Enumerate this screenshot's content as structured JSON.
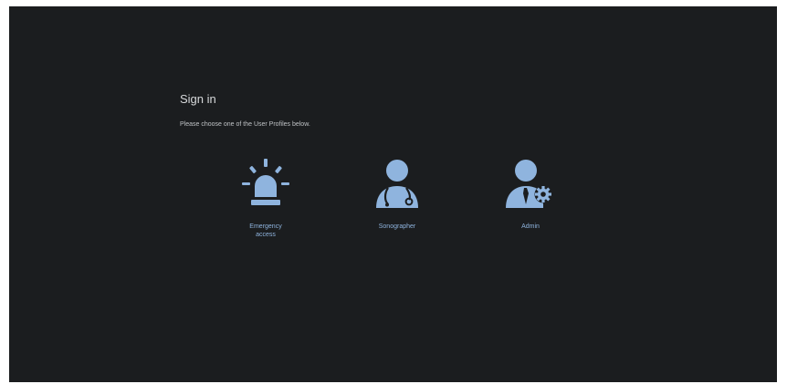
{
  "signin": {
    "title": "Sign in",
    "subtitle": "Please choose one of the User Profiles below."
  },
  "profiles": [
    {
      "label": "Emergency\naccess",
      "icon": "siren-icon"
    },
    {
      "label": "Sonographer",
      "icon": "doctor-stethoscope-icon"
    },
    {
      "label": "Admin",
      "icon": "user-gear-icon"
    }
  ],
  "colors": {
    "background": "#1b1d1f",
    "accent": "#8fb4de",
    "icon_fill": "#8fb4de"
  }
}
